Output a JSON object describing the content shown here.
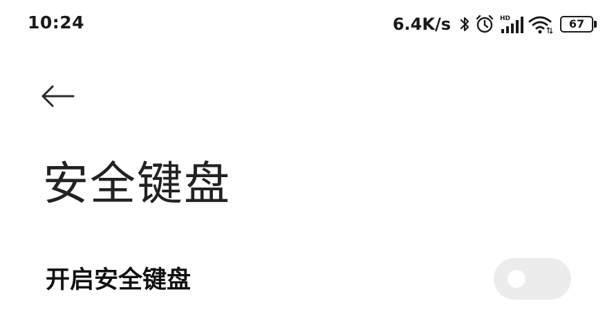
{
  "status_bar": {
    "time": "10:24",
    "net_speed": "6.4K/s",
    "battery_level": "67",
    "battery_percent": 67,
    "icons": [
      "bluetooth-icon",
      "alarm-icon",
      "cellular-signal-icon",
      "wifi-icon",
      "battery-icon"
    ],
    "hd_label": "HD"
  },
  "header": {
    "back_icon": "arrow-left-icon",
    "title": "安全键盘"
  },
  "settings": {
    "secure_keyboard": {
      "label": "开启安全键盘",
      "enabled": false
    }
  },
  "colors": {
    "background": "#ffffff",
    "text_primary": "#111111",
    "toggle_off_track": "#ececec",
    "toggle_knob": "#ffffff"
  }
}
